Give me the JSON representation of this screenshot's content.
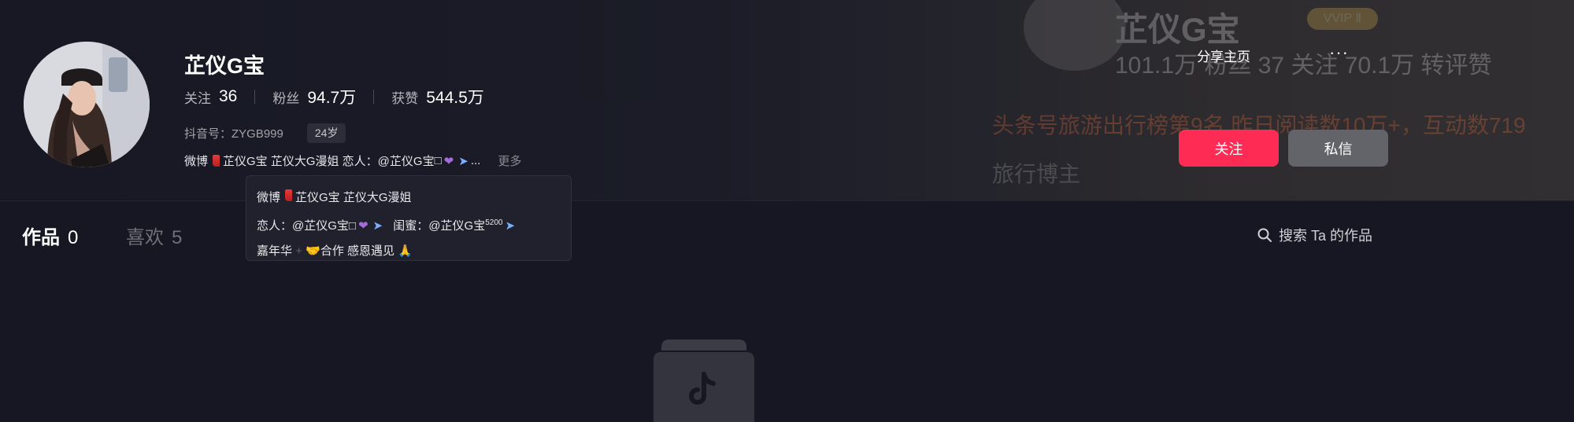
{
  "profile": {
    "name": "芷仪G宝",
    "stats": {
      "following_label": "关注",
      "following_value": "36",
      "fans_label": "粉丝",
      "fans_value": "94.7万",
      "likes_label": "获赞",
      "likes_value": "544.5万"
    },
    "douyin_id": "抖音号：ZYGB999",
    "age": "24岁",
    "bio": {
      "prefix": "微博",
      "main": "芷仪G宝 芷仪大G漫姐 恋人：@芷仪G宝",
      "more": "更多"
    }
  },
  "tooltip": {
    "line1_prefix": "微博",
    "line1_text": "芷仪G宝 芷仪大G漫姐",
    "line2_a": "恋人：@芷仪G宝",
    "line2_b": "闺蜜：@芷仪G宝",
    "line2_sup": "5200",
    "line3_a": "嘉年华",
    "line3_b": "合作 感恩遇见"
  },
  "actions": {
    "share": "分享主页",
    "more": "···",
    "follow": "关注",
    "message": "私信"
  },
  "tabs": [
    {
      "label": "作品",
      "count": "0"
    },
    {
      "label": "喜欢",
      "count": "5"
    }
  ],
  "search": {
    "label": "搜索 Ta 的作品"
  },
  "background_card": {
    "name": "芷仪G宝",
    "vip": "VVIP Ⅱ",
    "stats": "101.1万 粉丝    37 关注    70.1万 转评赞",
    "line_orange": "头条号旅游出行榜第9名    昨日阅读数10万+，互动数719",
    "line_grey": "旅行博主"
  },
  "colors": {
    "background": "#161722",
    "follow_button": "#fe2c55",
    "message_button": "#63636a",
    "tab_active": "#ffffff",
    "tab_inactive": "#6e6f77"
  }
}
